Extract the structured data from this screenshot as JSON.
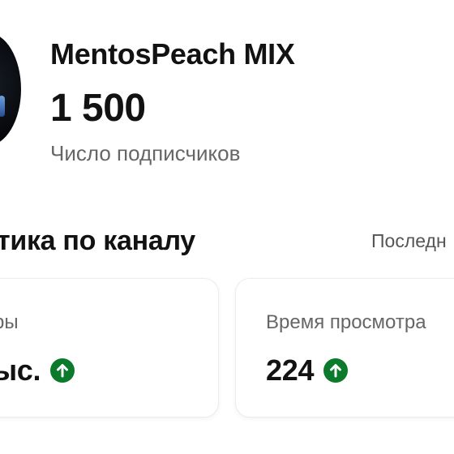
{
  "channel": {
    "name": "MentosPeach MIX",
    "subscribers_value": "1 500",
    "subscribers_label": "Число подписчиков"
  },
  "analytics": {
    "title": "тика по каналу",
    "period_label": "Последн"
  },
  "cards": [
    {
      "label": "тры",
      "value": "тыс.",
      "trend_icon": "arrow-up-circle-icon"
    },
    {
      "label": "Время просмотра",
      "value": "224",
      "trend_icon": "arrow-up-circle-icon"
    }
  ],
  "colors": {
    "trend_up": "#0b7a2a",
    "text_primary": "#121212",
    "text_secondary": "#666666"
  }
}
